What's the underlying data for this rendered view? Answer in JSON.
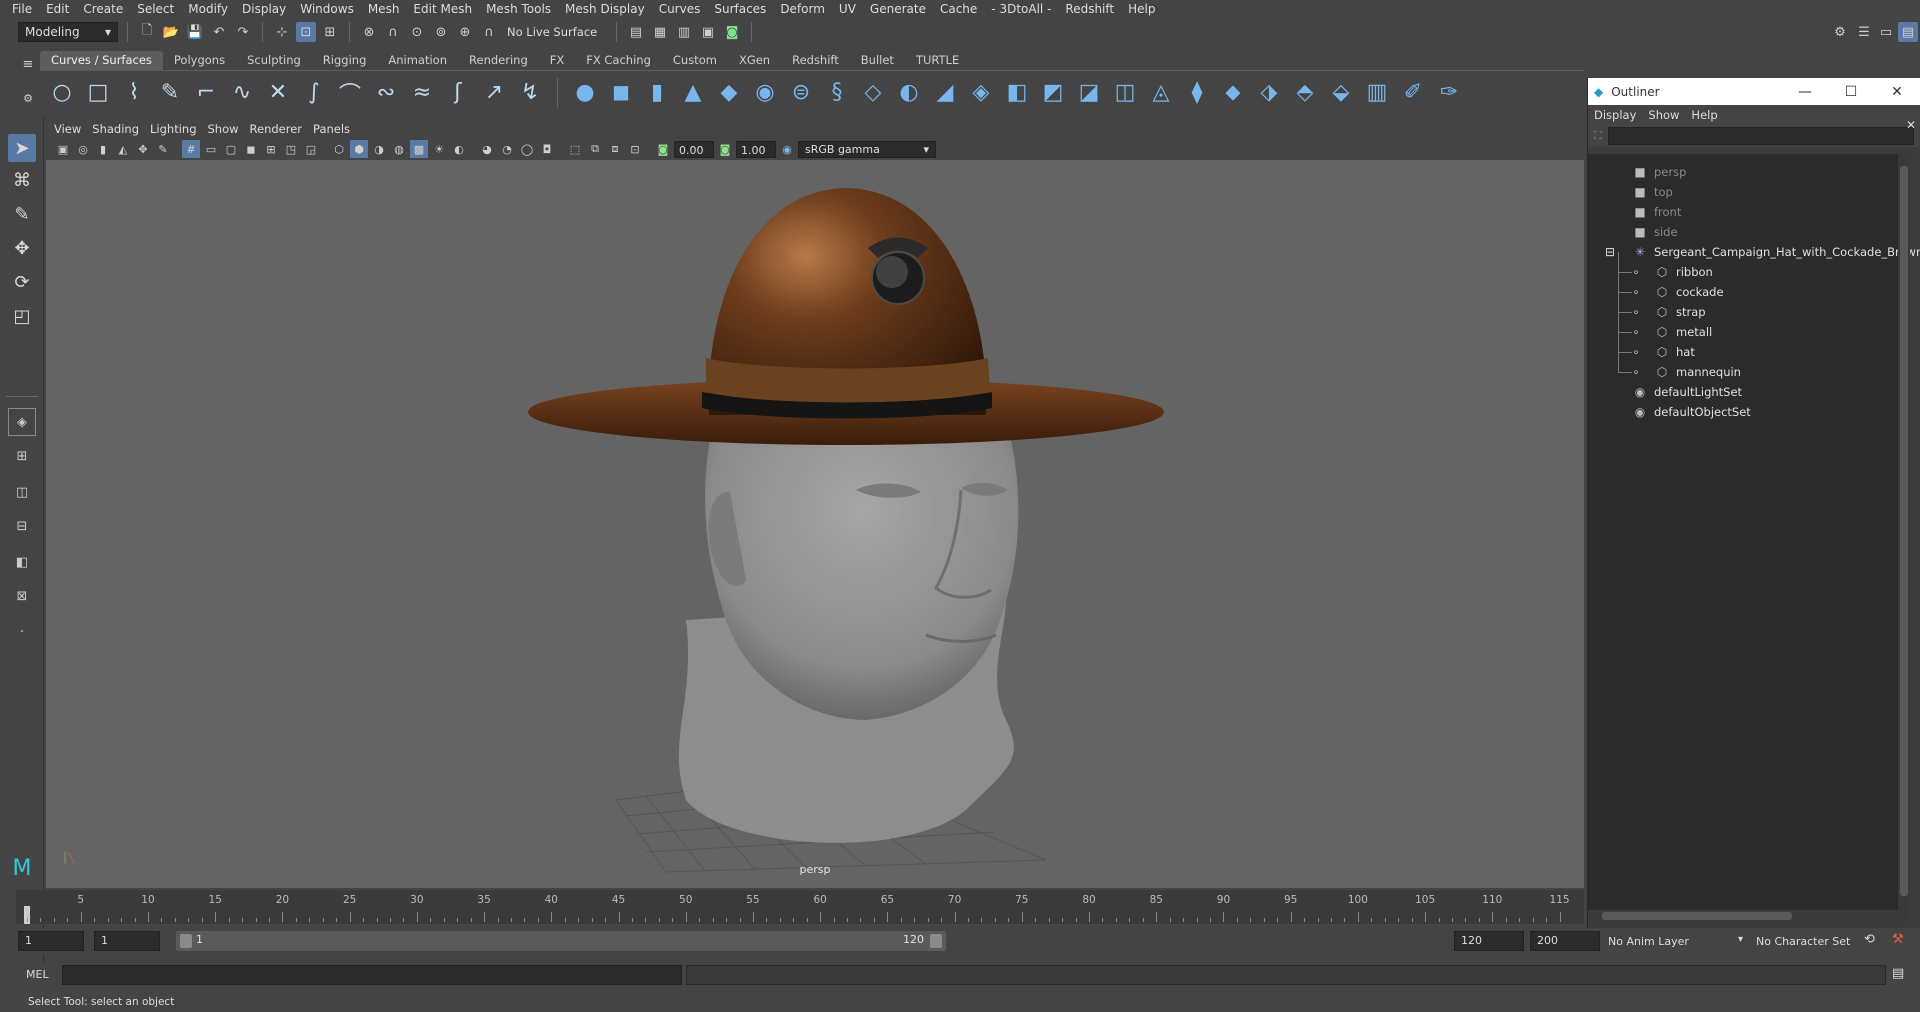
{
  "menubar": {
    "items": [
      "File",
      "Edit",
      "Create",
      "Select",
      "Modify",
      "Display",
      "Windows",
      "Mesh",
      "Edit Mesh",
      "Mesh Tools",
      "Mesh Display",
      "Curves",
      "Surfaces",
      "Deform",
      "UV",
      "Generate",
      "Cache",
      "- 3DtoAll -",
      "Redshift",
      "Help"
    ]
  },
  "statusline": {
    "menuset": "Modeling",
    "live_surface": "No Live Surface"
  },
  "shelf": {
    "tabs": [
      "Curves / Surfaces",
      "Polygons",
      "Sculpting",
      "Rigging",
      "Animation",
      "Rendering",
      "FX",
      "FX Caching",
      "Custom",
      "XGen",
      "Redshift",
      "Bullet",
      "TURTLE"
    ],
    "active_tab": "Curves / Surfaces"
  },
  "viewport": {
    "menu": [
      "View",
      "Shading",
      "Lighting",
      "Show",
      "Renderer",
      "Panels"
    ],
    "exposure": "0.00",
    "gamma": "1.00",
    "color_space": "sRGB gamma",
    "camera_label": "persp"
  },
  "outliner": {
    "title": "Outliner",
    "menu": [
      "Display",
      "Show",
      "Help"
    ],
    "rows": [
      {
        "label": "persp",
        "icon": "camera-icon",
        "dim": true
      },
      {
        "label": "top",
        "icon": "camera-icon",
        "dim": true
      },
      {
        "label": "front",
        "icon": "camera-icon",
        "dim": true
      },
      {
        "label": "side",
        "icon": "camera-icon",
        "dim": true
      },
      {
        "label": "Sergeant_Campaign_Hat_with_Cockade_Brown",
        "icon": "group-icon",
        "dim": false
      },
      {
        "label": "ribbon",
        "icon": "mesh-icon",
        "dim": false
      },
      {
        "label": "cockade",
        "icon": "mesh-icon",
        "dim": false
      },
      {
        "label": "strap",
        "icon": "mesh-icon",
        "dim": false
      },
      {
        "label": "metall",
        "icon": "mesh-icon",
        "dim": false
      },
      {
        "label": "hat",
        "icon": "mesh-icon",
        "dim": false
      },
      {
        "label": "mannequin",
        "icon": "mesh-icon",
        "dim": false
      },
      {
        "label": "defaultLightSet",
        "icon": "set-icon",
        "dim": false
      },
      {
        "label": "defaultObjectSet",
        "icon": "set-icon",
        "dim": false
      }
    ]
  },
  "timeslider": {
    "ticks": [
      "5",
      "10",
      "15",
      "20",
      "25",
      "30",
      "35",
      "40",
      "45",
      "50",
      "55",
      "60",
      "65",
      "70",
      "75",
      "80",
      "85",
      "90",
      "95",
      "100",
      "105",
      "110",
      "115"
    ],
    "current_frame": "1"
  },
  "rangeslider": {
    "start_time": "1",
    "playback_start": "1",
    "range_start_label": "1",
    "range_end_label": "120",
    "playback_end": "120",
    "end_time": "200",
    "anim_layer": "No Anim Layer",
    "character_set": "No Character Set"
  },
  "commandline": {
    "language": "MEL"
  },
  "helpline": {
    "text": "Select Tool: select an object"
  },
  "colors": {
    "accent": "#5a7aa6",
    "shelf_icon": "#78b7ee"
  }
}
